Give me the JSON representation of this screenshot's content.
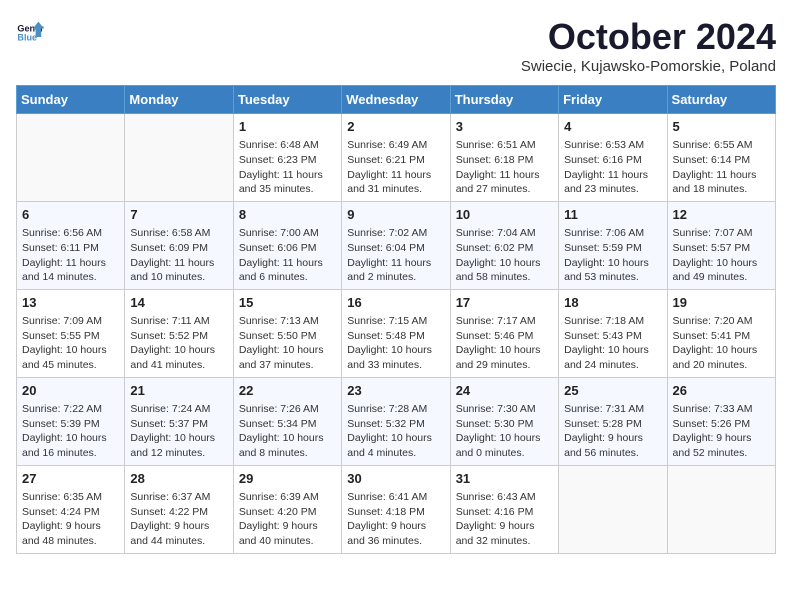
{
  "header": {
    "logo_line1": "General",
    "logo_line2": "Blue",
    "month": "October 2024",
    "location": "Swiecie, Kujawsko-Pomorskie, Poland"
  },
  "days_of_week": [
    "Sunday",
    "Monday",
    "Tuesday",
    "Wednesday",
    "Thursday",
    "Friday",
    "Saturday"
  ],
  "weeks": [
    [
      {
        "day": "",
        "info": ""
      },
      {
        "day": "",
        "info": ""
      },
      {
        "day": "1",
        "info": "Sunrise: 6:48 AM\nSunset: 6:23 PM\nDaylight: 11 hours and 35 minutes."
      },
      {
        "day": "2",
        "info": "Sunrise: 6:49 AM\nSunset: 6:21 PM\nDaylight: 11 hours and 31 minutes."
      },
      {
        "day": "3",
        "info": "Sunrise: 6:51 AM\nSunset: 6:18 PM\nDaylight: 11 hours and 27 minutes."
      },
      {
        "day": "4",
        "info": "Sunrise: 6:53 AM\nSunset: 6:16 PM\nDaylight: 11 hours and 23 minutes."
      },
      {
        "day": "5",
        "info": "Sunrise: 6:55 AM\nSunset: 6:14 PM\nDaylight: 11 hours and 18 minutes."
      }
    ],
    [
      {
        "day": "6",
        "info": "Sunrise: 6:56 AM\nSunset: 6:11 PM\nDaylight: 11 hours and 14 minutes."
      },
      {
        "day": "7",
        "info": "Sunrise: 6:58 AM\nSunset: 6:09 PM\nDaylight: 11 hours and 10 minutes."
      },
      {
        "day": "8",
        "info": "Sunrise: 7:00 AM\nSunset: 6:06 PM\nDaylight: 11 hours and 6 minutes."
      },
      {
        "day": "9",
        "info": "Sunrise: 7:02 AM\nSunset: 6:04 PM\nDaylight: 11 hours and 2 minutes."
      },
      {
        "day": "10",
        "info": "Sunrise: 7:04 AM\nSunset: 6:02 PM\nDaylight: 10 hours and 58 minutes."
      },
      {
        "day": "11",
        "info": "Sunrise: 7:06 AM\nSunset: 5:59 PM\nDaylight: 10 hours and 53 minutes."
      },
      {
        "day": "12",
        "info": "Sunrise: 7:07 AM\nSunset: 5:57 PM\nDaylight: 10 hours and 49 minutes."
      }
    ],
    [
      {
        "day": "13",
        "info": "Sunrise: 7:09 AM\nSunset: 5:55 PM\nDaylight: 10 hours and 45 minutes."
      },
      {
        "day": "14",
        "info": "Sunrise: 7:11 AM\nSunset: 5:52 PM\nDaylight: 10 hours and 41 minutes."
      },
      {
        "day": "15",
        "info": "Sunrise: 7:13 AM\nSunset: 5:50 PM\nDaylight: 10 hours and 37 minutes."
      },
      {
        "day": "16",
        "info": "Sunrise: 7:15 AM\nSunset: 5:48 PM\nDaylight: 10 hours and 33 minutes."
      },
      {
        "day": "17",
        "info": "Sunrise: 7:17 AM\nSunset: 5:46 PM\nDaylight: 10 hours and 29 minutes."
      },
      {
        "day": "18",
        "info": "Sunrise: 7:18 AM\nSunset: 5:43 PM\nDaylight: 10 hours and 24 minutes."
      },
      {
        "day": "19",
        "info": "Sunrise: 7:20 AM\nSunset: 5:41 PM\nDaylight: 10 hours and 20 minutes."
      }
    ],
    [
      {
        "day": "20",
        "info": "Sunrise: 7:22 AM\nSunset: 5:39 PM\nDaylight: 10 hours and 16 minutes."
      },
      {
        "day": "21",
        "info": "Sunrise: 7:24 AM\nSunset: 5:37 PM\nDaylight: 10 hours and 12 minutes."
      },
      {
        "day": "22",
        "info": "Sunrise: 7:26 AM\nSunset: 5:34 PM\nDaylight: 10 hours and 8 minutes."
      },
      {
        "day": "23",
        "info": "Sunrise: 7:28 AM\nSunset: 5:32 PM\nDaylight: 10 hours and 4 minutes."
      },
      {
        "day": "24",
        "info": "Sunrise: 7:30 AM\nSunset: 5:30 PM\nDaylight: 10 hours and 0 minutes."
      },
      {
        "day": "25",
        "info": "Sunrise: 7:31 AM\nSunset: 5:28 PM\nDaylight: 9 hours and 56 minutes."
      },
      {
        "day": "26",
        "info": "Sunrise: 7:33 AM\nSunset: 5:26 PM\nDaylight: 9 hours and 52 minutes."
      }
    ],
    [
      {
        "day": "27",
        "info": "Sunrise: 6:35 AM\nSunset: 4:24 PM\nDaylight: 9 hours and 48 minutes."
      },
      {
        "day": "28",
        "info": "Sunrise: 6:37 AM\nSunset: 4:22 PM\nDaylight: 9 hours and 44 minutes."
      },
      {
        "day": "29",
        "info": "Sunrise: 6:39 AM\nSunset: 4:20 PM\nDaylight: 9 hours and 40 minutes."
      },
      {
        "day": "30",
        "info": "Sunrise: 6:41 AM\nSunset: 4:18 PM\nDaylight: 9 hours and 36 minutes."
      },
      {
        "day": "31",
        "info": "Sunrise: 6:43 AM\nSunset: 4:16 PM\nDaylight: 9 hours and 32 minutes."
      },
      {
        "day": "",
        "info": ""
      },
      {
        "day": "",
        "info": ""
      }
    ]
  ]
}
